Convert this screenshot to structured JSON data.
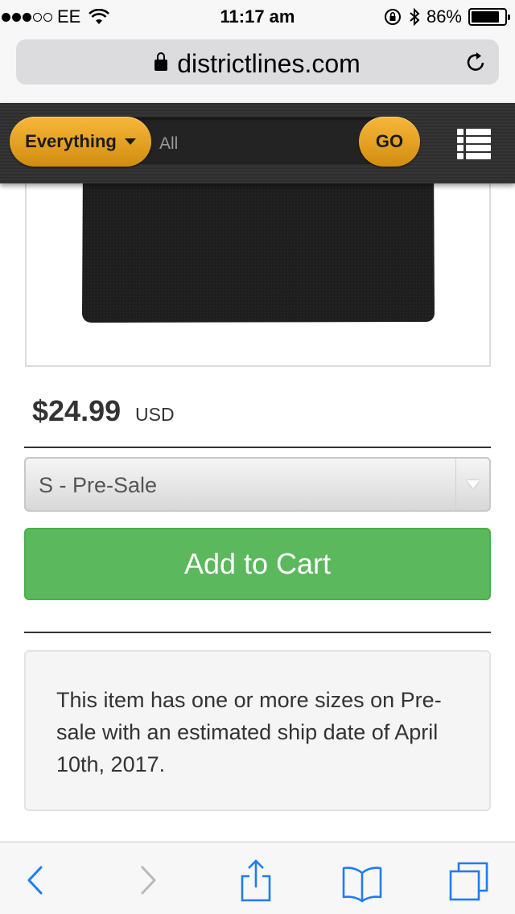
{
  "status_bar": {
    "carrier": "EE",
    "time": "11:17 am",
    "battery_percent": "86%",
    "battery_level": 0.86,
    "signal_bars_filled": 3,
    "signal_bars_total": 5
  },
  "browser": {
    "url": "districtlines.com"
  },
  "site_header": {
    "category_label": "Everything",
    "search_placeholder": "All",
    "go_label": "GO",
    "accent_color": "#E9A21F"
  },
  "product": {
    "price": "$24.99",
    "currency": "USD",
    "selected_size": "S - Pre-Sale",
    "add_to_cart_label": "Add to Cart",
    "add_to_cart_color": "#5CB85C",
    "presale_notice": "This item has one or more sizes on Pre-sale with an estimated ship date of April 10th, 2017."
  },
  "toolbar": {
    "icons": [
      "back-icon",
      "forward-icon",
      "share-icon",
      "bookmarks-icon",
      "tabs-icon"
    ],
    "tint_color": "#1E7CF2"
  }
}
